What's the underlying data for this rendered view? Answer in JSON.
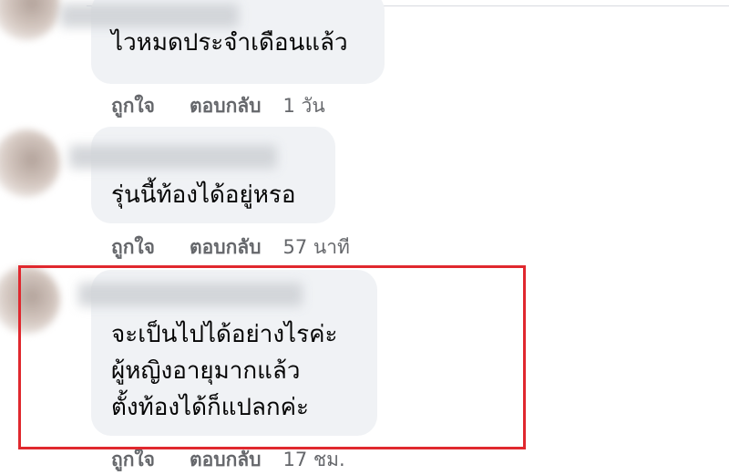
{
  "comments": [
    {
      "lines": [
        "ไวหมดประจำเดือนแล้ว"
      ],
      "like_label": "ถูกใจ",
      "reply_label": "ตอบกลับ",
      "time": "1 วัน"
    },
    {
      "lines": [
        "รุ่นนี้ท้องได้อยู่หรอ"
      ],
      "like_label": "ถูกใจ",
      "reply_label": "ตอบกลับ",
      "time": "57 นาที"
    },
    {
      "lines": [
        "จะเป็นไปได้อย่างไรค่ะ",
        "ผู้หญิงอายุมากแล้ว",
        "ตั้งท้องได้ก็แปลกค่ะ"
      ],
      "like_label": "ถูกใจ",
      "reply_label": "ตอบกลับ",
      "time": "17 ชม.",
      "highlighted": true
    }
  ],
  "colors": {
    "bubble": "#f0f2f5",
    "action_text": "#65676b",
    "highlight_border": "#e0282e"
  }
}
